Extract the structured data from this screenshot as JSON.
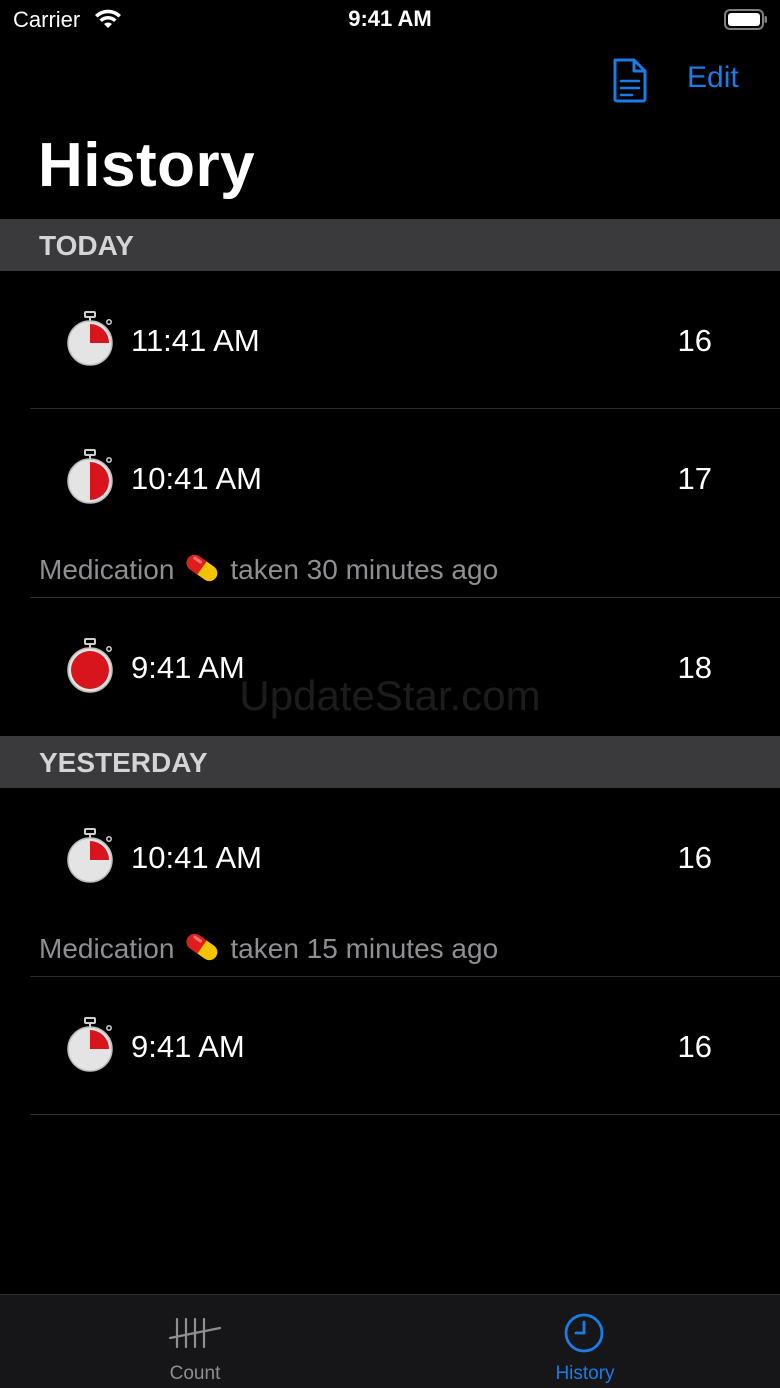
{
  "status_bar": {
    "carrier": "Carrier",
    "time": "9:41 AM",
    "wifi_icon": "wifi-icon",
    "battery_icon": "battery-full-icon"
  },
  "nav": {
    "export_icon": "document-icon",
    "edit_label": "Edit",
    "title": "History",
    "accent_color": "#1a7ce6"
  },
  "sections": [
    {
      "header": "TODAY",
      "rows": [
        {
          "time": "11:41 AM",
          "count": "16",
          "timer_fill": 0.25
        },
        {
          "time": "10:41 AM",
          "count": "17",
          "timer_fill": 0.5
        },
        {
          "note_prefix": "Medication",
          "note_suffix": "taken 30 minutes ago",
          "icon": "pill-icon"
        },
        {
          "time": "9:41 AM",
          "count": "18",
          "timer_fill": 1.0
        }
      ]
    },
    {
      "header": "YESTERDAY",
      "rows": [
        {
          "time": "10:41 AM",
          "count": "16",
          "timer_fill": 0.25
        },
        {
          "note_prefix": "Medication",
          "note_suffix": "taken 15 minutes ago",
          "icon": "pill-icon"
        },
        {
          "time": "9:41 AM",
          "count": "16",
          "timer_fill": 0.25
        }
      ]
    }
  ],
  "watermark": "UpdateStar.com",
  "tab_bar": {
    "tabs": [
      {
        "label": "Count",
        "icon": "tally-marks-icon",
        "selected": false
      },
      {
        "label": "History",
        "icon": "clock-icon",
        "selected": true
      }
    ]
  }
}
